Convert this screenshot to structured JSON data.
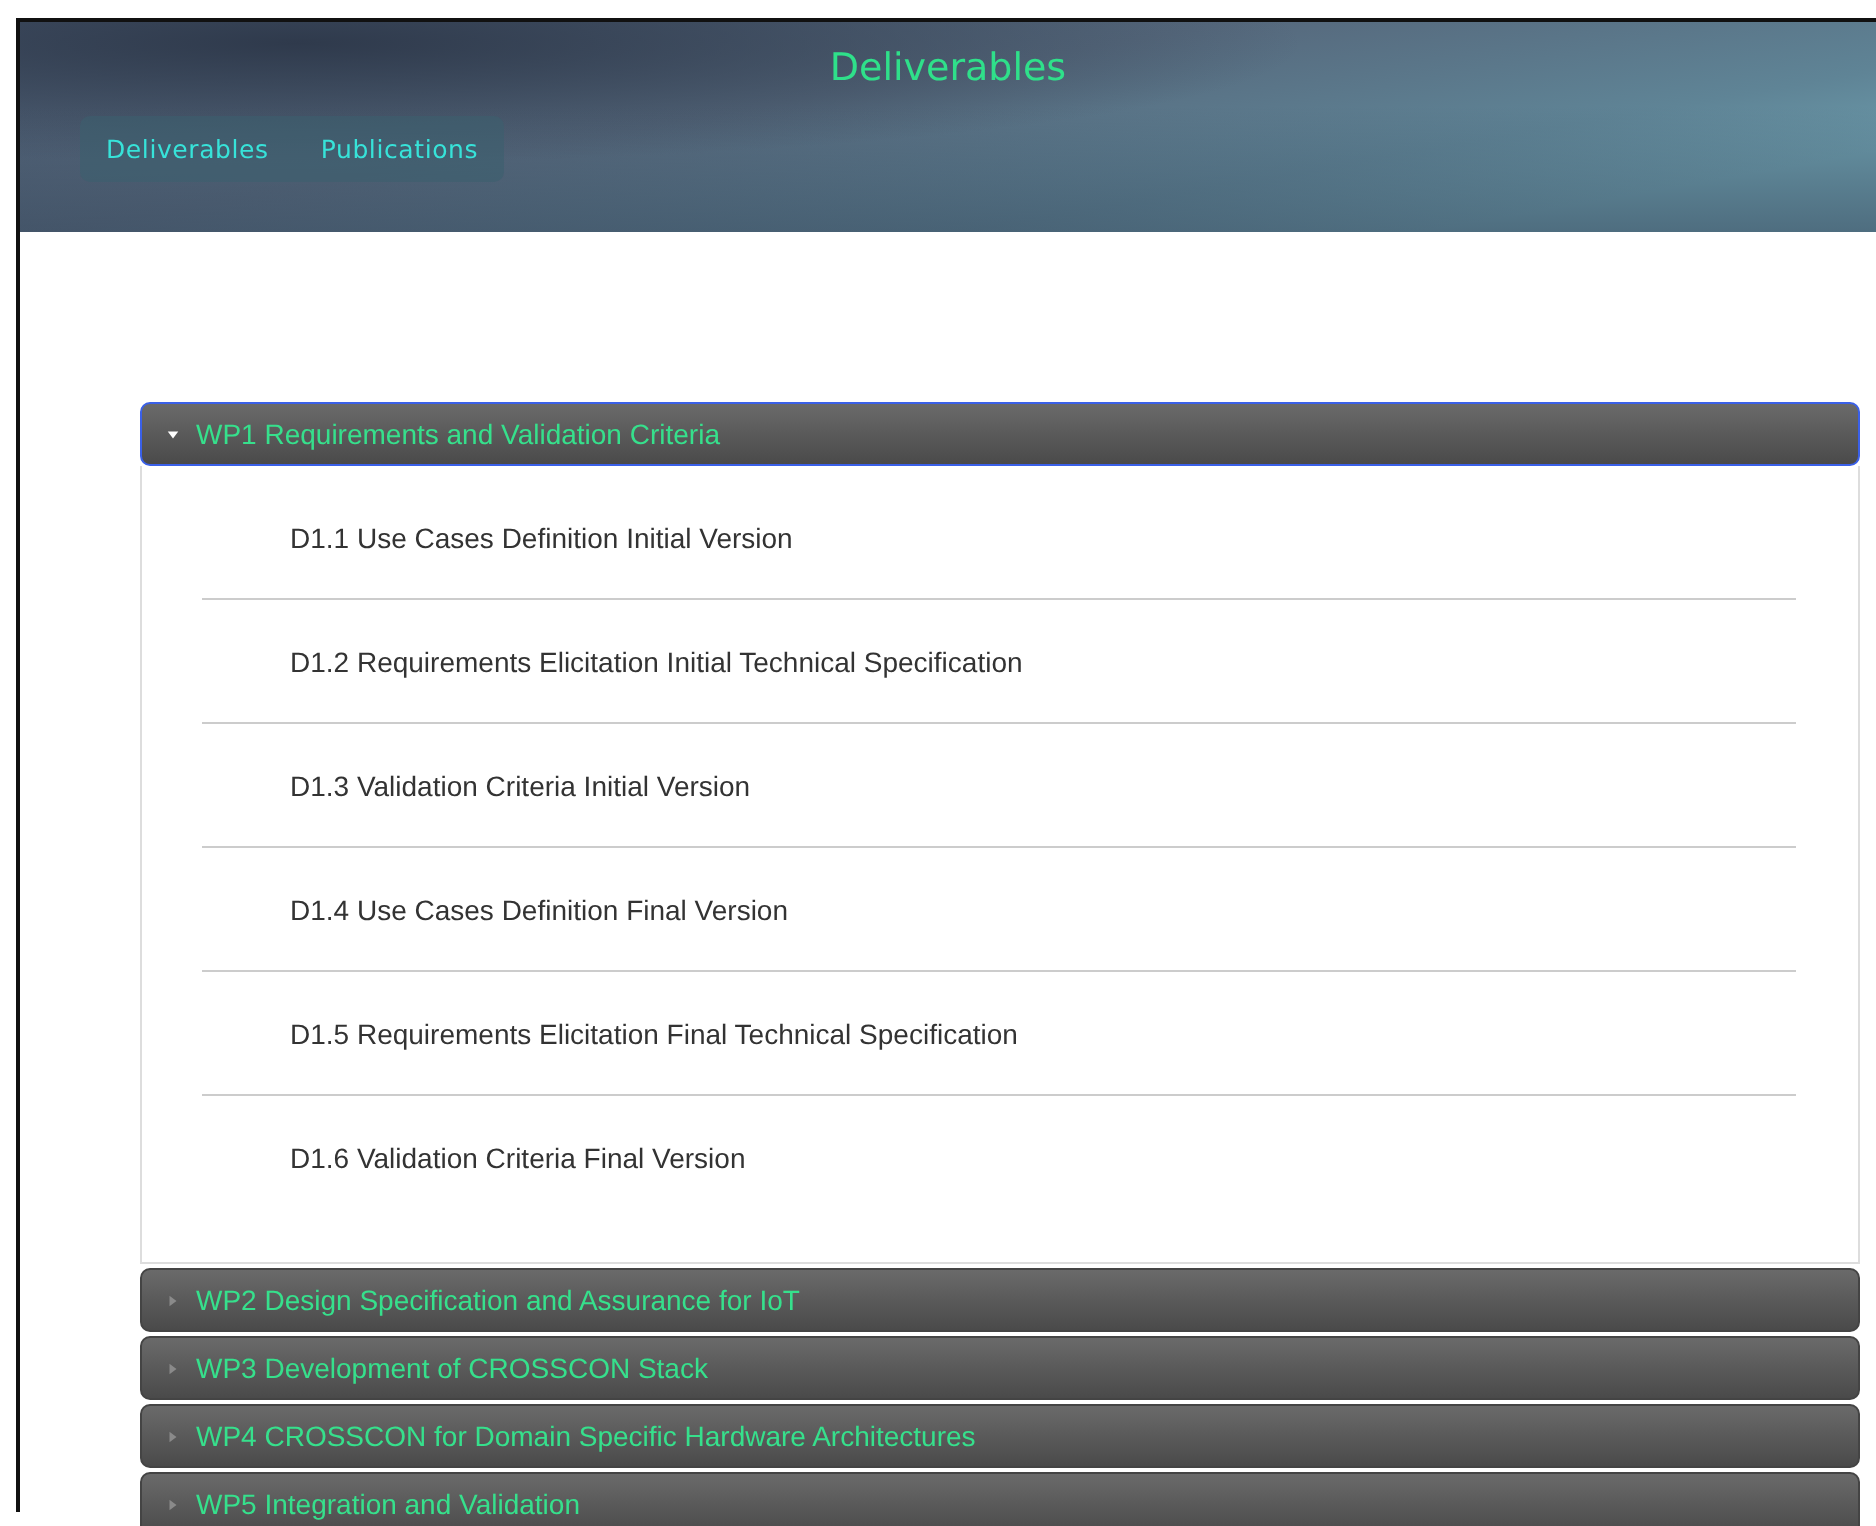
{
  "header": {
    "title": "Deliverables",
    "nav": [
      {
        "label": "Deliverables"
      },
      {
        "label": "Publications"
      }
    ]
  },
  "sections": [
    {
      "title": "WP1 Requirements and Validation Criteria",
      "expanded": true,
      "focused": true,
      "items": [
        "D1.1 Use Cases Definition Initial Version",
        "D1.2 Requirements Elicitation Initial Technical Specification",
        "D1.3 Validation Criteria Initial Version",
        "D1.4 Use Cases Definition Final Version",
        "D1.5 Requirements Elicitation Final Technical Specification",
        "D1.6 Validation Criteria Final Version"
      ]
    },
    {
      "title": "WP2 Design Specification and Assurance for IoT",
      "expanded": false,
      "focused": false
    },
    {
      "title": "WP3 Development of CROSSCON Stack",
      "expanded": false,
      "focused": false
    },
    {
      "title": "WP4 CROSSCON for Domain Specific Hardware Architectures",
      "expanded": false,
      "focused": false
    },
    {
      "title": "WP5 Integration and Validation",
      "expanded": false,
      "focused": false
    }
  ]
}
